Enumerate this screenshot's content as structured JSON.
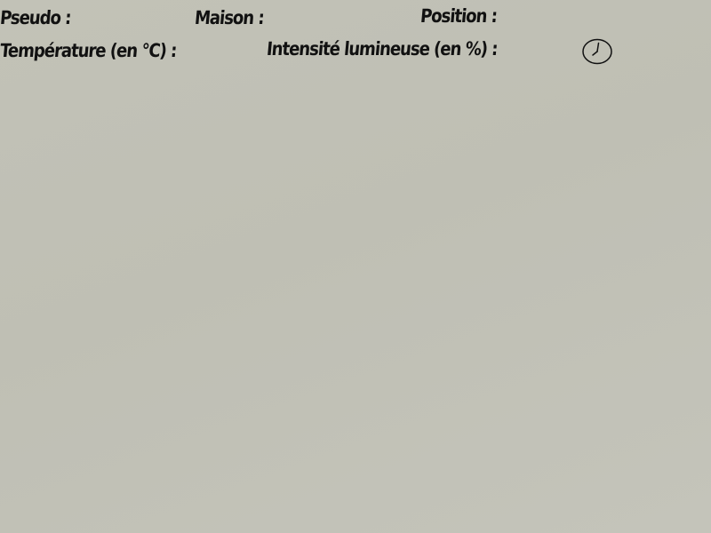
{
  "hud": {
    "pseudo_label": "Pseudo :",
    "maison_label": "Maison :",
    "position_label": "Position :",
    "temperature_label": "Température (en °C) :",
    "intensite_label": "Intensité lumineuse (en %) :"
  },
  "clock": {
    "icon": "clock-icon"
  },
  "colors": {
    "text": "#111111",
    "background": "#c2c2b7"
  }
}
